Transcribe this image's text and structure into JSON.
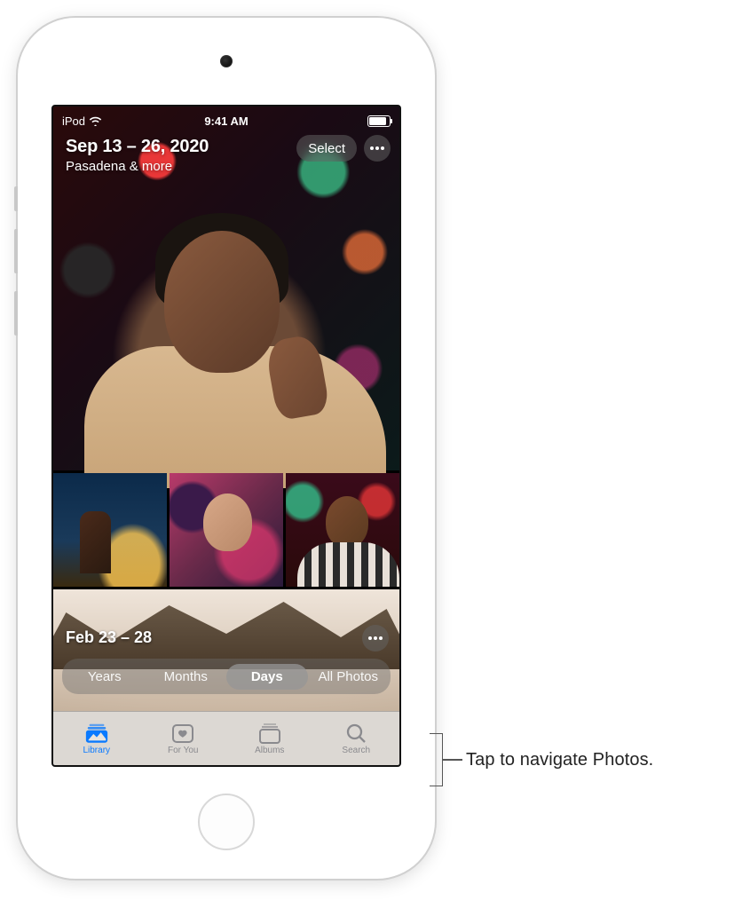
{
  "status_bar": {
    "carrier": "iPod",
    "time": "9:41 AM"
  },
  "hero": {
    "date_range": "Sep 13 – 26, 2020",
    "location": "Pasadena & more",
    "select_label": "Select"
  },
  "section2": {
    "date_range": "Feb 23 – 28"
  },
  "segmented": {
    "items": [
      "Years",
      "Months",
      "Days",
      "All Photos"
    ],
    "active_index": 2
  },
  "tabs": {
    "items": [
      "Library",
      "For You",
      "Albums",
      "Search"
    ],
    "active_index": 0
  },
  "callout": {
    "text": "Tap to navigate Photos."
  }
}
